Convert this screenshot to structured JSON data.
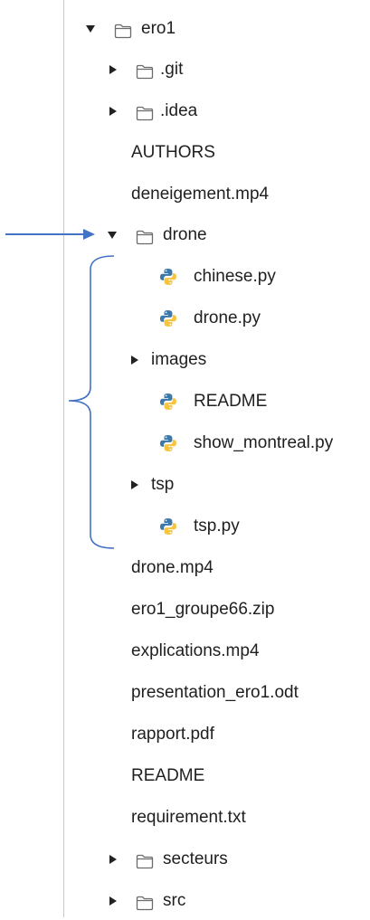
{
  "tree": {
    "root": {
      "label": "ero1",
      "expanded": true
    },
    "items": [
      {
        "label": ".git",
        "kind": "folder",
        "expanded": false
      },
      {
        "label": ".idea",
        "kind": "folder",
        "expanded": false
      },
      {
        "label": "AUTHORS",
        "kind": "file"
      },
      {
        "label": "deneigement.mp4",
        "kind": "file"
      },
      {
        "label": "drone",
        "kind": "folder",
        "expanded": true,
        "children": [
          {
            "label": "chinese.py",
            "kind": "python-file"
          },
          {
            "label": "drone.py",
            "kind": "python-file"
          },
          {
            "label": "images",
            "kind": "collapsed-group"
          },
          {
            "label": "README",
            "kind": "python-file"
          },
          {
            "label": "show_montreal.py",
            "kind": "python-file"
          },
          {
            "label": "tsp",
            "kind": "collapsed-group"
          },
          {
            "label": "tsp.py",
            "kind": "python-file"
          }
        ]
      },
      {
        "label": "drone.mp4",
        "kind": "file"
      },
      {
        "label": "ero1_groupe66.zip",
        "kind": "file"
      },
      {
        "label": "explications.mp4",
        "kind": "file"
      },
      {
        "label": "presentation_ero1.odt",
        "kind": "file"
      },
      {
        "label": "rapport.pdf",
        "kind": "file"
      },
      {
        "label": "README",
        "kind": "file"
      },
      {
        "label": "requirement.txt",
        "kind": "file"
      },
      {
        "label": "secteurs",
        "kind": "folder",
        "expanded": false
      },
      {
        "label": "src",
        "kind": "folder",
        "expanded": false
      }
    ]
  },
  "icons": {
    "expanded_caret": "triangle-down-icon",
    "collapsed_caret": "triangle-right-icon",
    "folder": "folder-outline-icon",
    "python": "python-logo-icon"
  },
  "colors": {
    "annotation": "#4472c4",
    "python_blue": "#3c78aa",
    "python_yellow": "#f5c542",
    "folder_stroke": "#6b6b6b",
    "caret": "#222222"
  }
}
